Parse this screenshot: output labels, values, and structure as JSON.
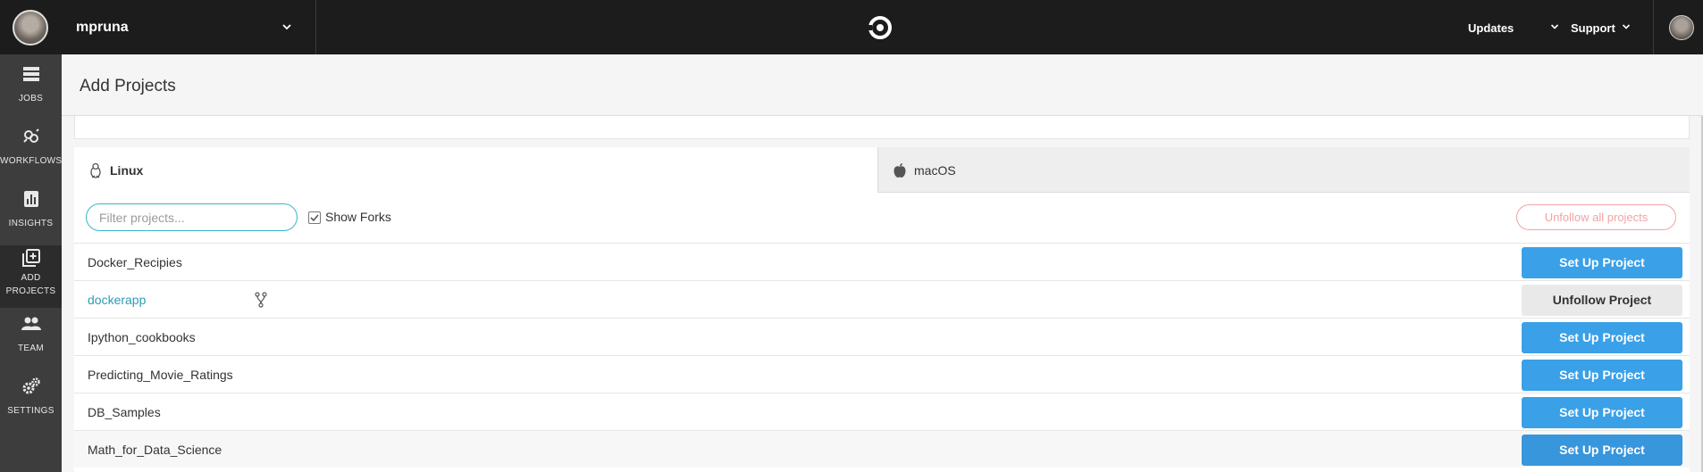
{
  "topbar": {
    "org_name": "mpruna",
    "nav": [
      {
        "label": "Updates"
      },
      {
        "label": "Support"
      }
    ]
  },
  "sidebar": {
    "items": [
      {
        "label": "JOBS",
        "icon": "jobs-icon"
      },
      {
        "label": "WORKFLOWS",
        "icon": "workflows-icon"
      },
      {
        "label": "INSIGHTS",
        "icon": "insights-icon"
      },
      {
        "label_line1": "ADD",
        "label_line2": "PROJECTS",
        "icon": "add-projects-icon",
        "active": true
      },
      {
        "label": "TEAM",
        "icon": "team-icon"
      },
      {
        "label": "SETTINGS",
        "icon": "settings-icon"
      }
    ]
  },
  "page": {
    "title": "Add Projects"
  },
  "os_tabs": [
    {
      "label": "Linux",
      "icon": "linux-icon",
      "selected": true
    },
    {
      "label": "macOS",
      "icon": "apple-icon",
      "selected": false
    }
  ],
  "controls": {
    "filter_placeholder": "Filter projects...",
    "filter_value": "",
    "show_forks_label": "Show Forks",
    "show_forks_checked": true,
    "unfollow_all_label": "Unfollow all projects"
  },
  "projects": [
    {
      "name": "Docker_Recipies",
      "followed": false,
      "fork": false,
      "action": "Set Up Project"
    },
    {
      "name": "dockerapp",
      "followed": true,
      "fork": true,
      "action": "Unfollow Project"
    },
    {
      "name": "Ipython_cookbooks",
      "followed": false,
      "fork": false,
      "action": "Set Up Project"
    },
    {
      "name": "Predicting_Movie_Ratings",
      "followed": false,
      "fork": false,
      "action": "Set Up Project"
    },
    {
      "name": "DB_Samples",
      "followed": false,
      "fork": false,
      "action": "Set Up Project"
    },
    {
      "name": "Math_for_Data_Science",
      "followed": false,
      "fork": false,
      "action": "Set Up Project"
    }
  ],
  "colors": {
    "topbar_bg": "#1c1c1c",
    "sidebar_bg": "#3d3d3d",
    "primary_button": "#3aa0e8",
    "link": "#2e9cb5",
    "danger_outline": "#f2a3a3",
    "filter_border": "#34b6c8"
  }
}
